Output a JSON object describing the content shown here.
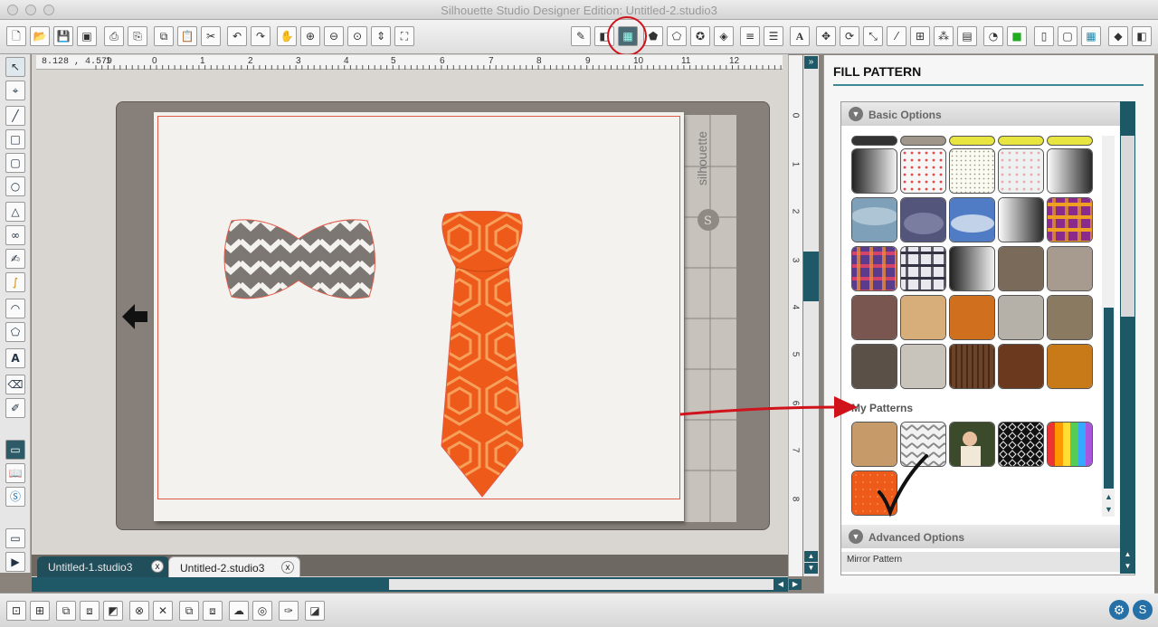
{
  "window": {
    "title": "Silhouette Studio Designer Edition: Untitled-2.studio3"
  },
  "ruler": {
    "coordinate": "8.128 , 4.579",
    "h_ticks": [
      "1",
      "0",
      "1",
      "2",
      "3",
      "4",
      "5",
      "6",
      "7",
      "8",
      "9",
      "10",
      "11",
      "12"
    ],
    "v_ticks": [
      "0",
      "1",
      "2",
      "3",
      "4",
      "5",
      "6",
      "7",
      "8"
    ]
  },
  "mat": {
    "brand": "silhouette"
  },
  "tabs": [
    {
      "label": "Untitled-1.studio3",
      "close": "x"
    },
    {
      "label": "Untitled-2.studio3",
      "close": "x"
    }
  ],
  "panel": {
    "title": "FILL PATTERN",
    "basic_options": "Basic Options",
    "my_patterns": "My Patterns",
    "advanced_options": "Advanced Options",
    "mirror_pattern": "Mirror Pattern"
  },
  "colors": {
    "accent": "#1f5866",
    "annotation_red": "#d0121a",
    "tie_orange": "#ee5a1a",
    "chevron_gray": "#7d7773"
  },
  "icons": {
    "toolbar": [
      "new-document-icon",
      "open-icon",
      "save-icon",
      "save-to-library-icon",
      "print-icon",
      "print-cut-icon",
      "copy-icon",
      "paste-icon",
      "cut-icon",
      "undo-icon",
      "redo-icon",
      "pan-icon",
      "zoom-in-icon",
      "zoom-out-icon",
      "zoom-selection-icon",
      "drag-zoom-icon",
      "fit-to-window-icon",
      "grid-icon",
      "page-settings-icon",
      "fill-pattern-icon",
      "fill-color-icon",
      "shape-icon",
      "star-icon",
      "gradient-icon",
      "line-color-icon",
      "line-style-icon",
      "text-style-icon",
      "transform-icon",
      "rotate-icon",
      "scale-icon",
      "knife-icon",
      "align-icon",
      "replicate-icon",
      "offset-icon",
      "trace-icon",
      "send-to-cutter-icon",
      "store-icon",
      "mat-icon",
      "library-icon",
      "design-icon",
      "panel-toggle-icon"
    ],
    "left": [
      "select-icon",
      "edit-points-icon",
      "line-icon",
      "rectangle-icon",
      "rounded-rectangle-icon",
      "ellipse-icon",
      "polygon-icon",
      "curve-icon",
      "freehand-icon",
      "smooth-freehand-icon",
      "arc-icon",
      "regular-polygon-icon",
      "text-icon",
      "eraser-icon",
      "knife-tool-icon",
      "design-view-icon",
      "library-view-icon",
      "store-icon",
      "panel-icon",
      "play-icon"
    ]
  }
}
